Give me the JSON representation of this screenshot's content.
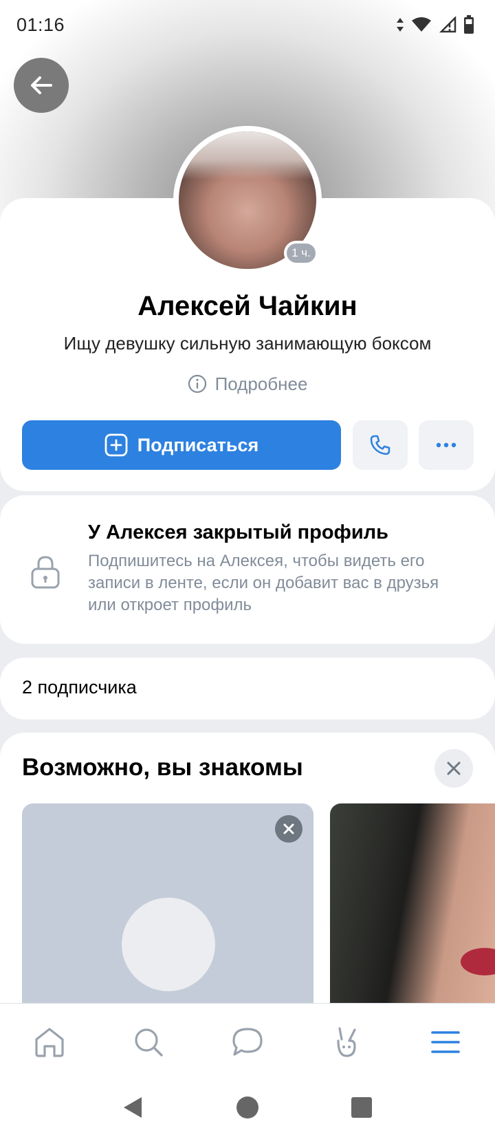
{
  "status_bar": {
    "time": "01:16",
    "icons": [
      "data-arrows-icon",
      "wifi-icon",
      "signal-icon",
      "battery-icon"
    ]
  },
  "profile": {
    "name": "Алексей Чайкин",
    "status": "Ищу девушку сильную занимающую боксом",
    "online_badge": "1 ч.",
    "more_info_label": "Подробнее"
  },
  "actions": {
    "subscribe_label": "Подписаться"
  },
  "closed_profile": {
    "title": "У Алексея закрытый профиль",
    "description": "Подпишитесь на Алексея, чтобы видеть его записи в ленте, если он добавит вас в друзья или откроет профиль"
  },
  "followers": {
    "label": "2 подписчика"
  },
  "suggestions": {
    "title": "Возможно, вы знакомы"
  },
  "tabbar": {
    "items": [
      "home-icon",
      "search-icon",
      "messages-icon",
      "clips-icon",
      "menu-icon"
    ],
    "active": "menu-icon"
  },
  "colors": {
    "accent": "#2d81e0",
    "secondary_text": "#818c99",
    "background": "#ebedf0"
  }
}
